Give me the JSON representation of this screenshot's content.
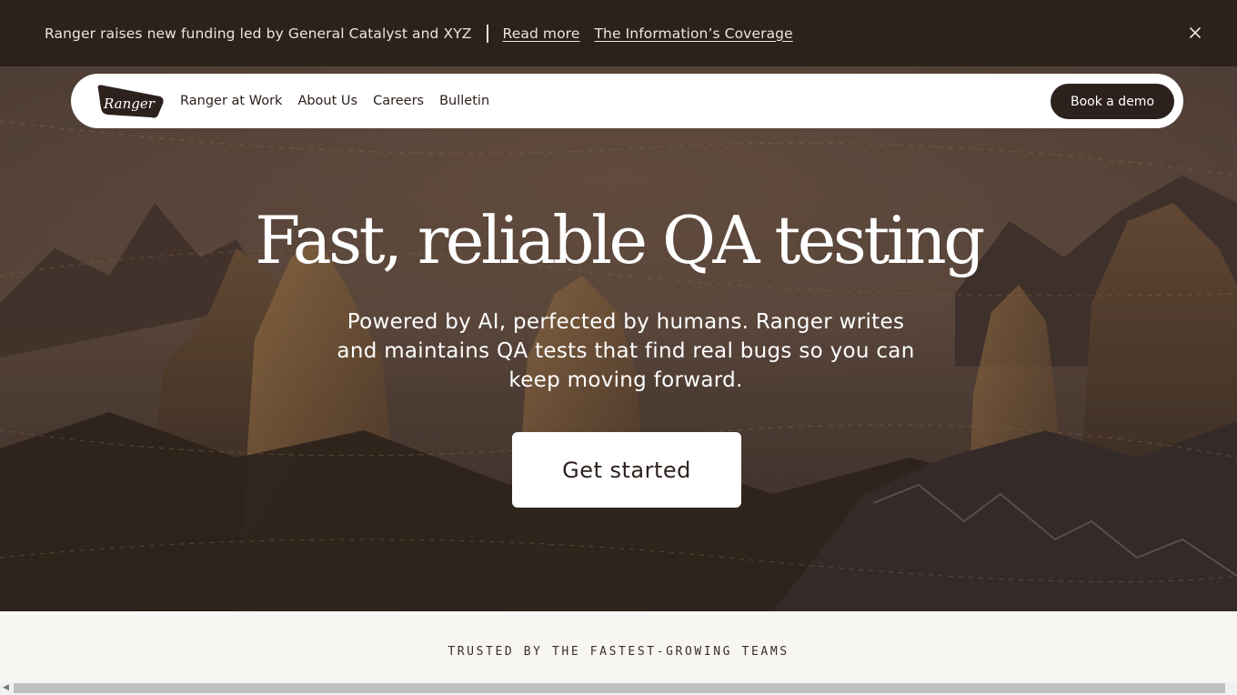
{
  "announcement": {
    "text": "Ranger raises new funding led by General Catalyst and XYZ",
    "read_more": "Read more",
    "coverage_link": "The Information’s Coverage",
    "close_icon": "close-icon"
  },
  "nav": {
    "logo_text": "Ranger",
    "links": [
      "Ranger at Work",
      "About Us",
      "Careers",
      "Bulletin"
    ],
    "cta": "Book a demo"
  },
  "hero": {
    "headline": "Fast, reliable QA testing",
    "subtext": "Powered by AI, perfected by humans. Ranger writes and maintains QA tests that find real bugs so you can keep moving forward.",
    "cta": "Get started",
    "background": "mountain-landscape-image"
  },
  "trusted": {
    "label": "TRUSTED BY THE FASTEST-GROWING TEAMS"
  },
  "colors": {
    "dark_brown": "#2c211d",
    "cream": "#f7f6f2",
    "white": "#ffffff"
  }
}
